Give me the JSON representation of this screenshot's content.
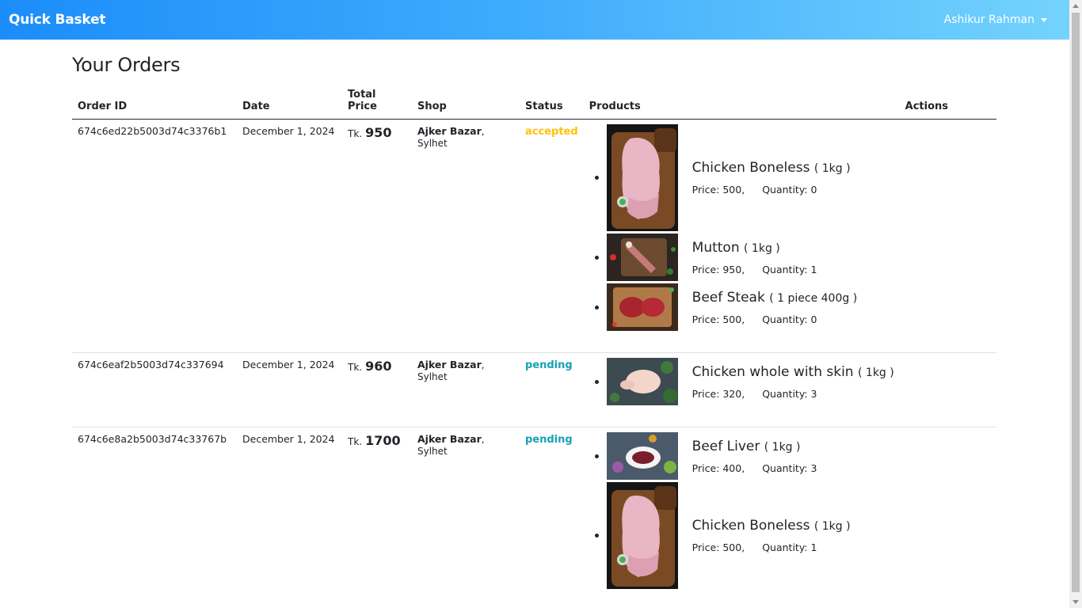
{
  "brand": "Quick Basket",
  "user": {
    "name": "Ashikur Rahman"
  },
  "page": {
    "title": "Your Orders"
  },
  "table": {
    "headers": {
      "order_id": "Order ID",
      "date": "Date",
      "total_price": "Total Price",
      "shop": "Shop",
      "status": "Status",
      "products": "Products",
      "actions": "Actions"
    },
    "price_prefix": "Tk.",
    "price_label": "Price:",
    "quantity_label": "Quantity:"
  },
  "orders": [
    {
      "id": "674c6ed22b5003d74c3376b1",
      "date": "December 1, 2024",
      "total": "950",
      "shop": "Ajker Bazar",
      "city": ", Sylhet",
      "status": "accepted",
      "products": [
        {
          "name": "Chicken Boneless",
          "unit": "( 1kg )",
          "price": "500,",
          "quantity": "0",
          "image": "chicken-boneless"
        },
        {
          "name": "Mutton",
          "unit": "( 1kg )",
          "price": "950,",
          "quantity": "1",
          "image": "mutton"
        },
        {
          "name": "Beef Steak",
          "unit": "( 1 piece 400g )",
          "price": "500,",
          "quantity": "0",
          "image": "beef-steak"
        }
      ]
    },
    {
      "id": "674c6eaf2b5003d74c337694",
      "date": "December 1, 2024",
      "total": "960",
      "shop": "Ajker Bazar",
      "city": ", Sylhet",
      "status": "pending",
      "products": [
        {
          "name": "Chicken whole with skin",
          "unit": "( 1kg )",
          "price": "320,",
          "quantity": "3",
          "image": "chicken-whole"
        }
      ]
    },
    {
      "id": "674c6e8a2b5003d74c33767b",
      "date": "December 1, 2024",
      "total": "1700",
      "shop": "Ajker Bazar",
      "city": ", Sylhet",
      "status": "pending",
      "products": [
        {
          "name": "Beef Liver",
          "unit": "( 1kg )",
          "price": "400,",
          "quantity": "3",
          "image": "beef-liver"
        },
        {
          "name": "Chicken Boneless",
          "unit": "( 1kg )",
          "price": "500,",
          "quantity": "1",
          "image": "chicken-boneless"
        }
      ]
    }
  ],
  "colors": {
    "accepted": "#ffc107",
    "pending": "#17a2b8",
    "navbar_start": "#1b8dfa",
    "navbar_end": "#74d3fd"
  }
}
